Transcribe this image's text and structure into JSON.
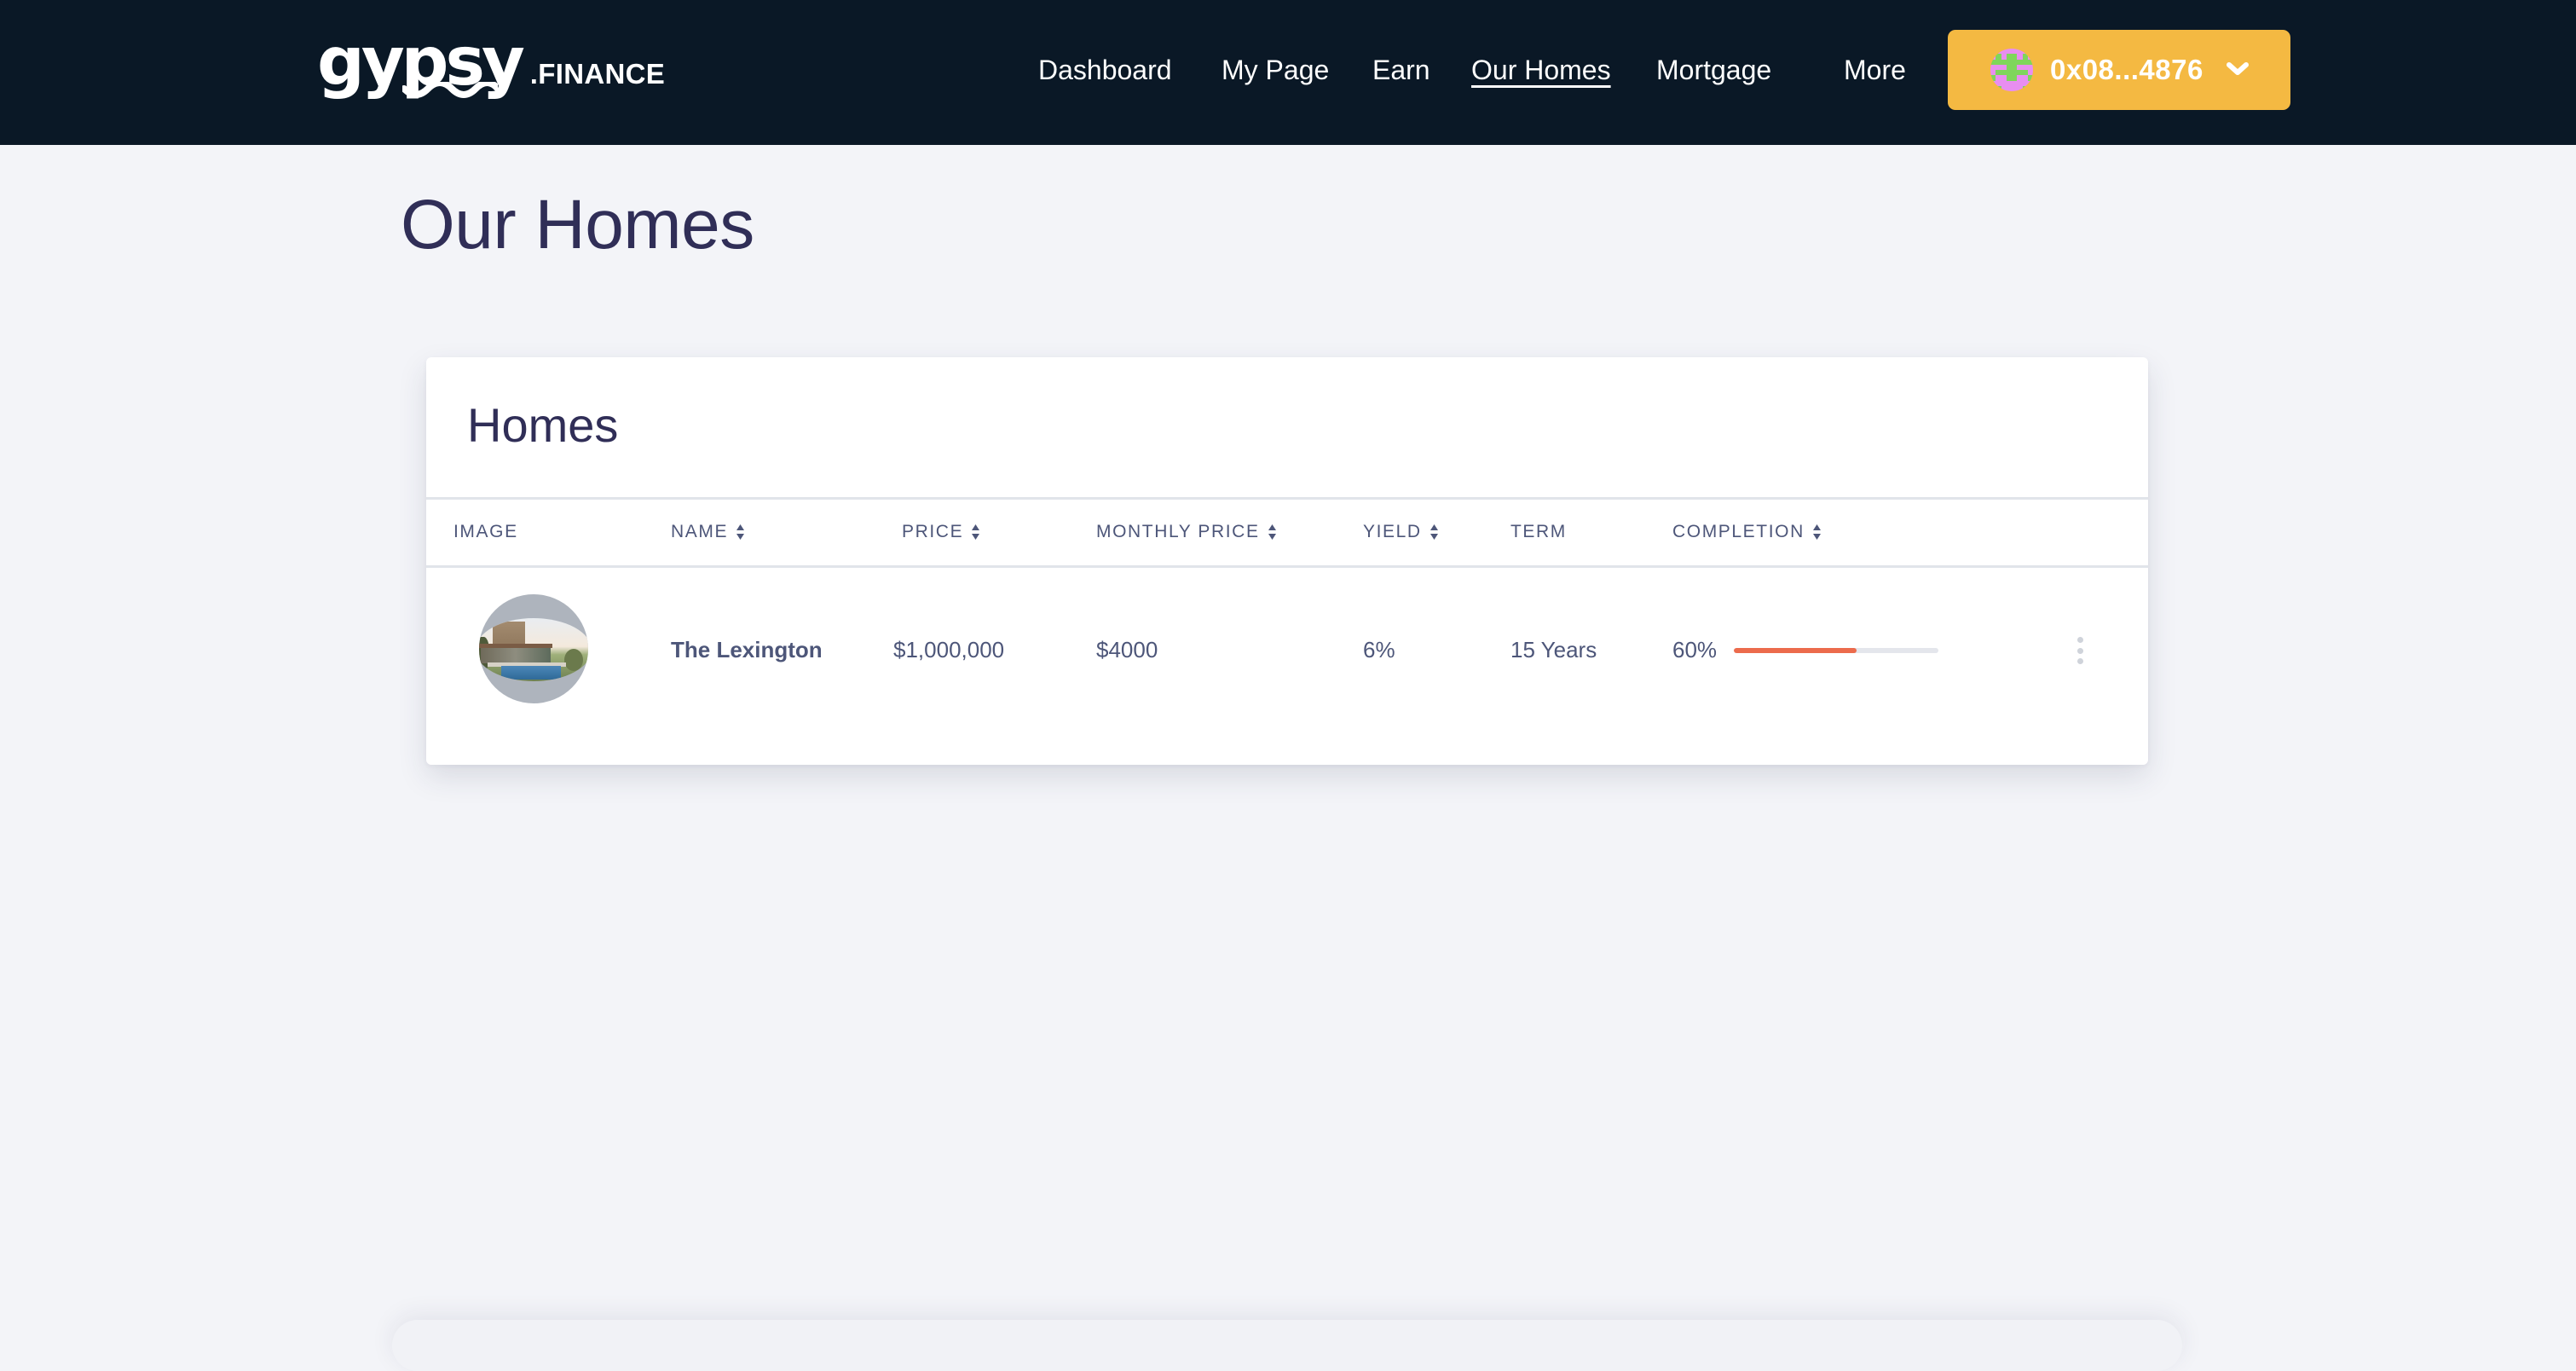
{
  "brand": {
    "wordmark": "gypsy",
    "suffix": ".FINANCE"
  },
  "nav": {
    "items": [
      {
        "label": "Dashboard",
        "active": false
      },
      {
        "label": "My Page",
        "active": false
      },
      {
        "label": "Earn",
        "active": false
      },
      {
        "label": "Our Homes",
        "active": true
      },
      {
        "label": "Mortgage",
        "active": false
      },
      {
        "label": "More",
        "active": false
      }
    ]
  },
  "wallet": {
    "address": "0x08...4876",
    "avatar_icon": "identicon",
    "chevron_icon": "chevron-down-icon"
  },
  "page": {
    "title": "Our Homes"
  },
  "homes_card": {
    "title": "Homes",
    "columns": [
      {
        "label": "IMAGE",
        "sortable": false
      },
      {
        "label": "NAME",
        "sortable": true
      },
      {
        "label": "PRICE",
        "sortable": true
      },
      {
        "label": "MONTHLY PRICE",
        "sortable": true
      },
      {
        "label": "YIELD",
        "sortable": true
      },
      {
        "label": "TERM",
        "sortable": false
      },
      {
        "label": "COMPLETION",
        "sortable": true
      }
    ],
    "rows": [
      {
        "image_alt": "house with pool",
        "name": "The Lexington",
        "price": "$1,000,000",
        "monthly_price": "$4000",
        "yield": "6%",
        "term": "15 Years",
        "completion_label": "60%",
        "completion_percent": 60
      }
    ]
  },
  "colors": {
    "header_bg": "#0a1826",
    "page_bg": "#f3f4f8",
    "wallet_bg": "#f4b942",
    "title_text": "#302e57",
    "table_text": "#4d5679",
    "progress_fill": "#ec6b4c",
    "progress_track": "#e4e6ec",
    "identicon_pink": "#e88ef0",
    "identicon_green": "#7fd65b"
  }
}
